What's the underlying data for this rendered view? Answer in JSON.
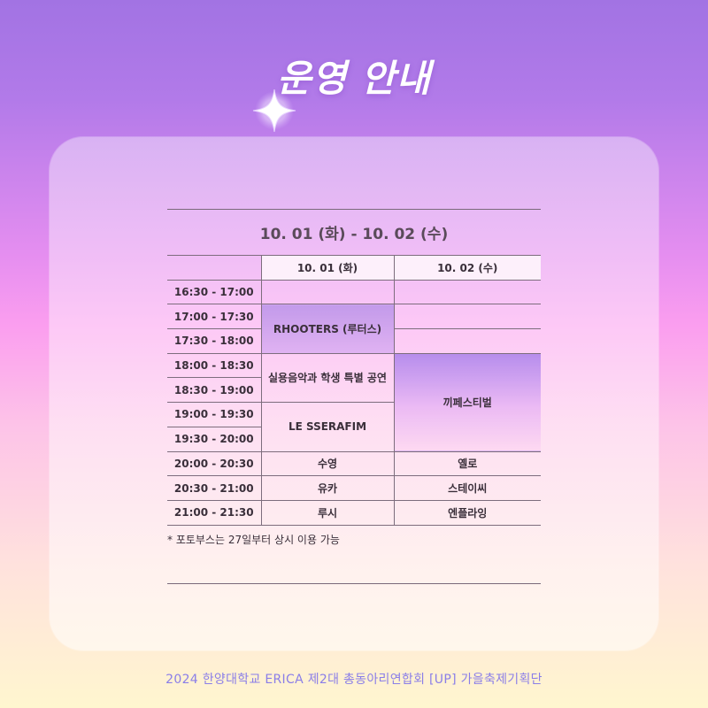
{
  "title": "운영 안내",
  "heading": "10. 01 (화) - 10. 02 (수)",
  "columns": [
    "10. 01 (화)",
    "10. 02 (수)"
  ],
  "times": [
    "16:30 - 17:00",
    "17:00 - 17:30",
    "17:30 - 18:00",
    "18:00 - 18:30",
    "18:30 - 19:00",
    "19:00 - 19:30",
    "19:30 - 20:00",
    "20:00 - 20:30",
    "20:30 - 21:00",
    "21:00 - 21:30"
  ],
  "day1": {
    "rhooters": "RHOOTERS (루터스)",
    "music_dept": "실용음악과 학생 특별 공연",
    "lesserafim": "LE SSERAFIM",
    "suyoung": "수영",
    "yuka": "유카",
    "lucy": "루시"
  },
  "day2": {
    "festival": "끼페스티벌",
    "yellow": "옐로",
    "stayc": "스테이씨",
    "nflying": "엔플라잉"
  },
  "note": "* 포토부스는 27일부터 상시 이용 가능",
  "footer": "2024 한양대학교 ERICA 제2대 총동아리연합회 [UP] 가을축제기획단",
  "colors": {
    "accent": "#c05ab8",
    "footer": "#8a7ee8",
    "highlight": "#b08ce6"
  },
  "icons": {
    "sparkle": "sparkle-icon"
  }
}
